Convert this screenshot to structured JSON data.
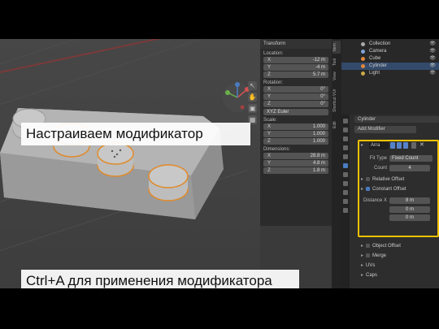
{
  "captions": {
    "top": "Настраиваем модификатор",
    "bottom": "Ctrl+A для применения модификатора"
  },
  "viewport": {
    "tools": [
      "cursor-icon",
      "hand-icon",
      "camera-icon",
      "grid-icon"
    ],
    "tool_glyphs": [
      "↖",
      "✋",
      "▣",
      "▦"
    ]
  },
  "transform_panel": {
    "header": "Transform",
    "location_label": "Location:",
    "location": [
      {
        "axis": "X",
        "value": "-12 m"
      },
      {
        "axis": "Y",
        "value": "-4 m"
      },
      {
        "axis": "Z",
        "value": "5.7 m"
      }
    ],
    "rotation_label": "Rotation:",
    "rotation": [
      {
        "axis": "X",
        "value": "0°"
      },
      {
        "axis": "Y",
        "value": "0°"
      },
      {
        "axis": "Z",
        "value": "0°"
      }
    ],
    "rotation_mode": "XYZ Euler",
    "scale_label": "Scale:",
    "scale": [
      {
        "axis": "X",
        "value": "1.000"
      },
      {
        "axis": "Y",
        "value": "1.000"
      },
      {
        "axis": "Z",
        "value": "1.000"
      }
    ],
    "dimensions_label": "Dimensions:",
    "dimensions": [
      {
        "axis": "X",
        "value": "28.8 m"
      },
      {
        "axis": "Y",
        "value": "4.8 m"
      },
      {
        "axis": "Z",
        "value": "1.8 m"
      }
    ]
  },
  "side_tabs": [
    "Item",
    "Tool",
    "View",
    "Shortcut VUr",
    "Edit"
  ],
  "outliner": {
    "rows": [
      {
        "label": "Collection",
        "selected": false
      },
      {
        "label": "Camera",
        "selected": false
      },
      {
        "label": "Cube",
        "selected": false
      },
      {
        "label": "Cylinder",
        "selected": true
      },
      {
        "label": "Light",
        "selected": false
      }
    ],
    "eye_glyph": "👁"
  },
  "properties": {
    "object_name": "Cylinder",
    "add_modifier": "Add Modifier",
    "modifier_name": "Arra",
    "fit_type_label": "Fit Type",
    "fit_type_value": "Fixed Count",
    "count_label": "Count",
    "count_value": "4",
    "relative_offset": "Relative Offset",
    "constant_offset": "Constant Offset",
    "distance_label": "Distance X",
    "distance_value": "8 m",
    "y_value": "0 m",
    "z_value": "0 m",
    "object_offset": "Object Offset",
    "merge": "Merge",
    "uvs": "UVs",
    "caps": "Caps",
    "arrow_glyph": "▸",
    "accent": "#f2c200"
  }
}
